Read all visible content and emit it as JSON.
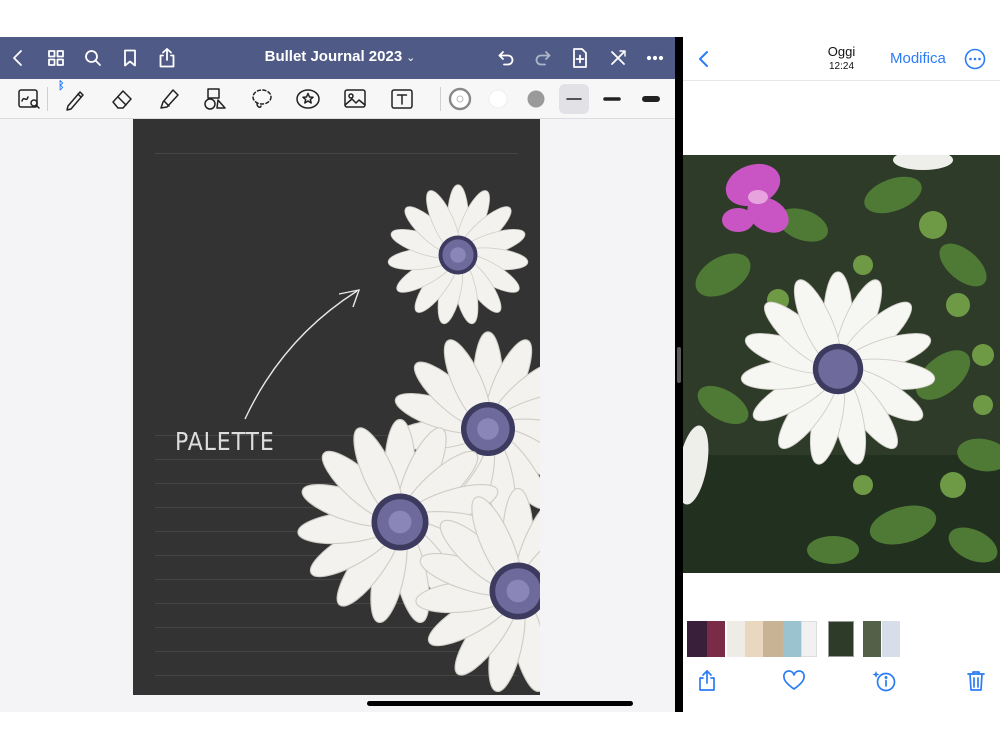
{
  "notes_app": {
    "title": "Bullet Journal 2023",
    "title_chevron": "⌄",
    "nav_icons": [
      "back-icon",
      "thumbnails-icon",
      "search-icon",
      "bookmark-icon",
      "share-icon",
      "undo-icon",
      "redo-icon",
      "add-page-icon",
      "read-only-icon",
      "more-icon"
    ],
    "tool_icons": [
      "zoom-window-icon",
      "pen-icon",
      "eraser-icon",
      "highlighter-icon",
      "shapes-icon",
      "lasso-icon",
      "elements-icon",
      "image-icon",
      "text-icon"
    ],
    "page_text": "PALETTE",
    "colors": {
      "nav": "#4f5b86",
      "page": "#333333"
    }
  },
  "photos_app": {
    "day": "Oggi",
    "time": "12:24",
    "edit_label": "Modifica",
    "toolbar_icons": [
      "share-icon",
      "favorite-icon",
      "info-icon",
      "trash-icon"
    ],
    "colors": {
      "accent": "#2b7cf5"
    }
  }
}
